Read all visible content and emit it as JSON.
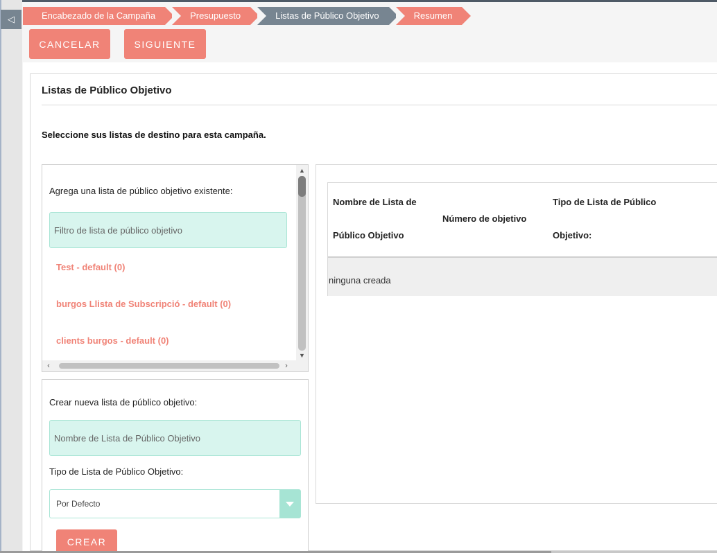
{
  "nav": {
    "collapse_icon": "◁"
  },
  "breadcrumbs": [
    {
      "label": "Encabezado de la Campaña",
      "active": false
    },
    {
      "label": "Presupuesto",
      "active": false
    },
    {
      "label": "Listas de Público Objetivo",
      "active": true
    },
    {
      "label": "Resumen",
      "active": false
    }
  ],
  "actions": {
    "cancel_label": "CANCELAR",
    "next_label": "SIGUIENTE"
  },
  "panel": {
    "title": "Listas de Público Objetivo",
    "instruction": "Seleccione sus listas de destino para esta campaña."
  },
  "existing": {
    "label": "Agrega una lista de público objetivo existente:",
    "filter_placeholder": "Filtro de lista de público objetivo",
    "items": [
      "Test - default (0)",
      "burgos Llista de Subscripció - default (0)",
      "clients burgos - default (0)"
    ]
  },
  "create": {
    "label": "Crear nueva lista de público objetivo:",
    "name_placeholder": "Nombre de Lista de Público Objetivo",
    "type_label": "Tipo de Lista de Público Objetivo:",
    "type_value": "Por Defecto",
    "create_label": "CREAR"
  },
  "table": {
    "col_name_line1": "Nombre de Lista de",
    "col_name_line2": "Público Objetivo",
    "col_number": "Número de objetivo",
    "col_type_line1": "Tipo de Lista de Público",
    "col_type_line2": "Objetivo:",
    "empty_text": "ninguna creada"
  },
  "colors": {
    "accent": "#f08377",
    "active_crumb": "#778591",
    "input_bg": "#d8f5ee"
  }
}
